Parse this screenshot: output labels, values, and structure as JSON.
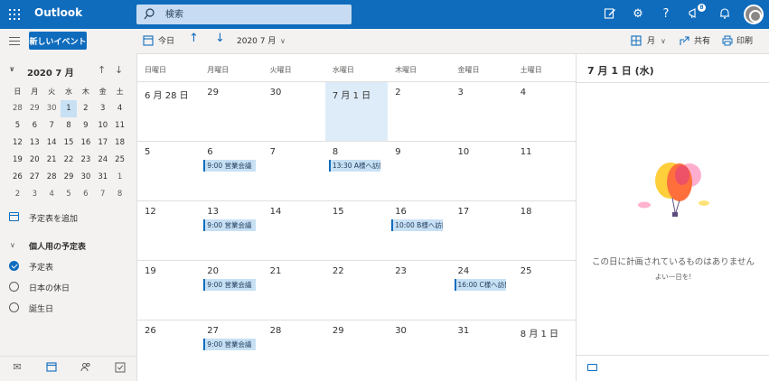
{
  "app": {
    "name": "Outlook"
  },
  "search": {
    "placeholder": "検索"
  },
  "topbar": {
    "notification_count": "8"
  },
  "left": {
    "new_event_label": "新しいイベント",
    "mini_calendar": {
      "title": "2020 7 月",
      "dow": [
        "日",
        "月",
        "火",
        "水",
        "木",
        "金",
        "土"
      ],
      "weeks": [
        [
          "28",
          "29",
          "30",
          "1",
          "2",
          "3",
          "4"
        ],
        [
          "5",
          "6",
          "7",
          "8",
          "9",
          "10",
          "11"
        ],
        [
          "12",
          "13",
          "14",
          "15",
          "16",
          "17",
          "18"
        ],
        [
          "19",
          "20",
          "21",
          "22",
          "23",
          "24",
          "25"
        ],
        [
          "26",
          "27",
          "28",
          "29",
          "30",
          "31",
          "1"
        ],
        [
          "2",
          "3",
          "4",
          "5",
          "6",
          "7",
          "8"
        ]
      ]
    },
    "add_calendar_label": "予定表を追加",
    "personal_section_label": "個人用の予定表",
    "calendars": [
      {
        "label": "予定表",
        "checked": true
      },
      {
        "label": "日本の休日",
        "checked": false
      },
      {
        "label": "誕生日",
        "checked": false
      }
    ]
  },
  "toolbar": {
    "today_label": "今日",
    "month_label": "2020 7 月",
    "view_label": "月",
    "share_label": "共有",
    "print_label": "印刷"
  },
  "calendar": {
    "dow": [
      "日曜日",
      "月曜日",
      "火曜日",
      "水曜日",
      "木曜日",
      "金曜日",
      "土曜日"
    ],
    "weeks": [
      {
        "days": [
          "6 月 28 日",
          "29",
          "30",
          "7 月 1 日",
          "2",
          "3",
          "4"
        ],
        "events": []
      },
      {
        "days": [
          "5",
          "6",
          "7",
          "8",
          "9",
          "10",
          "11"
        ],
        "events": [
          {
            "col": 1,
            "text": "9:00  営業会議"
          },
          {
            "col": 3,
            "text": "13:30  A様へ訪問"
          }
        ]
      },
      {
        "days": [
          "12",
          "13",
          "14",
          "15",
          "16",
          "17",
          "18"
        ],
        "events": [
          {
            "col": 1,
            "text": "9:00  営業会議"
          },
          {
            "col": 4,
            "text": "10:00  B様へ訪問"
          }
        ]
      },
      {
        "days": [
          "19",
          "20",
          "21",
          "22",
          "23",
          "24",
          "25"
        ],
        "events": [
          {
            "col": 1,
            "text": "9:00  営業会議"
          },
          {
            "col": 5,
            "text": "16:00  C様へ訪問"
          }
        ]
      },
      {
        "days": [
          "26",
          "27",
          "28",
          "29",
          "30",
          "31",
          "8 月 1 日"
        ],
        "events": [
          {
            "col": 1,
            "text": "9:00  営業会議"
          }
        ]
      }
    ]
  },
  "right": {
    "title": "7 月 1 日 (水)",
    "empty_main": "この日に計画されているものはありません",
    "empty_sub": "よい一日を!"
  },
  "colors": {
    "brand": "#0f6cbd",
    "today_bg": "#deecf9",
    "event_bg": "#c7e0f4"
  }
}
